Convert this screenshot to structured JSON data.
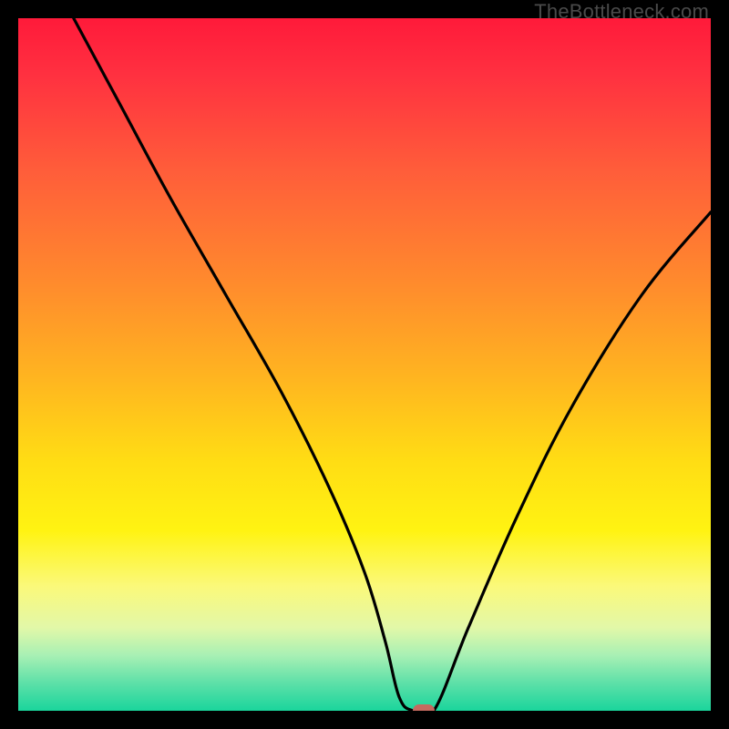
{
  "watermark": "TheBottleneck.com",
  "chart_data": {
    "type": "line",
    "title": "",
    "xlabel": "",
    "ylabel": "",
    "xlim": [
      0,
      100
    ],
    "ylim": [
      0,
      100
    ],
    "grid": false,
    "series": [
      {
        "name": "curve",
        "x": [
          8,
          15,
          22,
          30,
          38,
          45,
          50,
          53,
          55,
          57,
          60,
          65,
          72,
          80,
          90,
          100
        ],
        "values": [
          100,
          87,
          74,
          60,
          46,
          32,
          20,
          10,
          2,
          0,
          0,
          12,
          28,
          44,
          60,
          72
        ]
      }
    ],
    "marker": {
      "x": 58.5,
      "y": 0
    },
    "background_gradient": {
      "top": "#ff1a3a",
      "mid": "#ffdd14",
      "bottom": "#1ad59c"
    }
  }
}
